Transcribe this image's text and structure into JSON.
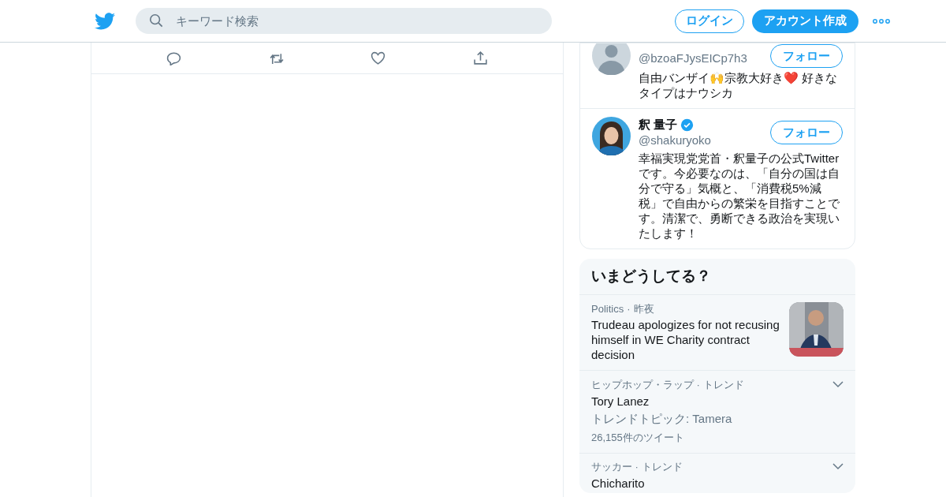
{
  "header": {
    "search": {
      "placeholder": "キーワード検索"
    },
    "login": "ログイン",
    "signup": "アカウント作成"
  },
  "tweet_actions": [
    {
      "kind": "reply"
    },
    {
      "kind": "retweet"
    },
    {
      "kind": "like"
    },
    {
      "kind": "share"
    }
  ],
  "who_to_follow": [
    {
      "kind": "placeholder",
      "handle": "@bzoaFJysEICp7h3",
      "verified": false,
      "follow": "フォロー",
      "bio": "自由バンザイ🙌宗教大好き❤️ 好きなタイプはナウシカ"
    },
    {
      "name": "釈 量子",
      "handle": "@shakuryoko",
      "verified": true,
      "follow": "フォロー",
      "bio": "幸福実現党党首・釈量子の公式Twitterです。今必要なのは、「自分の国は自分で守る」気概と、「消費税5%減税」で自由からの繁栄を目指すことです。清潔で、勇断できる政治を実現いたします！"
    }
  ],
  "trends": {
    "title": "いまどうしてる？",
    "items": [
      {
        "kind": "news",
        "category": "Politics",
        "separator": "·",
        "time": "昨夜",
        "headline": "Trudeau apologizes for not recusing himself in WE Charity contract decision"
      },
      {
        "kind": "trend",
        "category": "ヒップホップ・ラップ · トレンド",
        "headline": "Tory Lanez",
        "topic": "トレンドトピック: Tamera",
        "count": "26,155件のツイート"
      },
      {
        "kind": "trend",
        "category": "サッカー · トレンド",
        "headline": "Chicharito"
      }
    ]
  }
}
